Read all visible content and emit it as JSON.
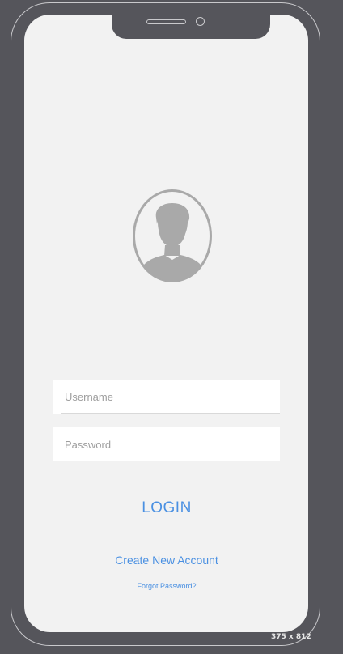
{
  "login_form": {
    "username_placeholder": "Username",
    "password_placeholder": "Password",
    "login_label": "LOGIN",
    "create_account_label": "Create New Account",
    "forgot_password_label": "Forgot Password?"
  },
  "avatar": {
    "icon": "user-silhouette-icon"
  },
  "artboard": {
    "dimensions_label": "375 x 812"
  },
  "colors": {
    "background": "#55555b",
    "screen": "#f2f2f2",
    "field": "#ffffff",
    "accent": "#4a90e2",
    "avatar": "#a9a9a9"
  }
}
